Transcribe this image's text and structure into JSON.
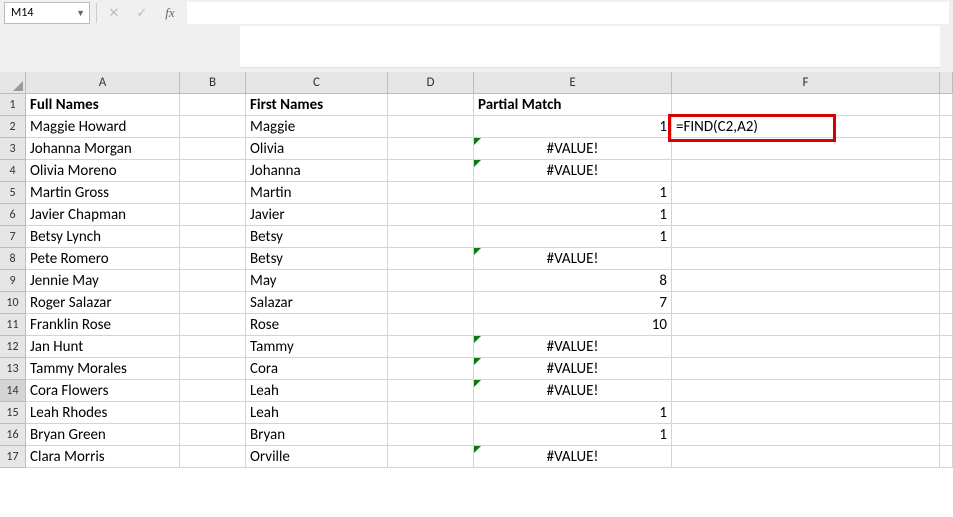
{
  "namebox": {
    "ref": "M14"
  },
  "formula_bar": {
    "value": ""
  },
  "fb_buttons": {
    "cancel": "✕",
    "enter": "✓",
    "fx": "fx"
  },
  "columns": [
    "A",
    "B",
    "C",
    "D",
    "E",
    "F",
    ""
  ],
  "headers": {
    "a": "Full Names",
    "c": "First Names",
    "e": "Partial Match"
  },
  "annotation": {
    "f2": "=FIND(C2,A2)"
  },
  "rows": [
    {
      "n": "1"
    },
    {
      "n": "2",
      "a": "Maggie Howard",
      "c": "Maggie",
      "e": "1",
      "e_right": true
    },
    {
      "n": "3",
      "a": "Johanna Morgan",
      "c": "Olivia",
      "e": "#VALUE!",
      "e_err": true
    },
    {
      "n": "4",
      "a": "Olivia Moreno",
      "c": "Johanna",
      "e": "#VALUE!",
      "e_err": true
    },
    {
      "n": "5",
      "a": "Martin Gross",
      "c": "Martin",
      "e": "1",
      "e_right": true
    },
    {
      "n": "6",
      "a": "Javier Chapman",
      "c": "Javier",
      "e": "1",
      "e_right": true
    },
    {
      "n": "7",
      "a": "Betsy Lynch",
      "c": "Betsy",
      "e": "1",
      "e_right": true
    },
    {
      "n": "8",
      "a": "Pete Romero",
      "c": "Betsy",
      "e": "#VALUE!",
      "e_err": true
    },
    {
      "n": "9",
      "a": "Jennie May",
      "c": "May",
      "e": "8",
      "e_right": true
    },
    {
      "n": "10",
      "a": "Roger Salazar",
      "c": "Salazar",
      "e": "7",
      "e_right": true
    },
    {
      "n": "11",
      "a": "Franklin Rose",
      "c": "Rose",
      "e": "10",
      "e_right": true
    },
    {
      "n": "12",
      "a": "Jan Hunt",
      "c": "Tammy",
      "e": "#VALUE!",
      "e_err": true
    },
    {
      "n": "13",
      "a": "Tammy Morales",
      "c": "Cora",
      "e": "#VALUE!",
      "e_err": true
    },
    {
      "n": "14",
      "a": "Cora Flowers",
      "c": "Leah",
      "e": "#VALUE!",
      "e_err": true,
      "active": true
    },
    {
      "n": "15",
      "a": "Leah Rhodes",
      "c": "Leah",
      "e": "1",
      "e_right": true
    },
    {
      "n": "16",
      "a": "Bryan Green",
      "c": "Bryan",
      "e": "1",
      "e_right": true
    },
    {
      "n": "17",
      "a": "Clara Morris",
      "c": "Orville",
      "e": "#VALUE!",
      "e_err": true
    }
  ]
}
